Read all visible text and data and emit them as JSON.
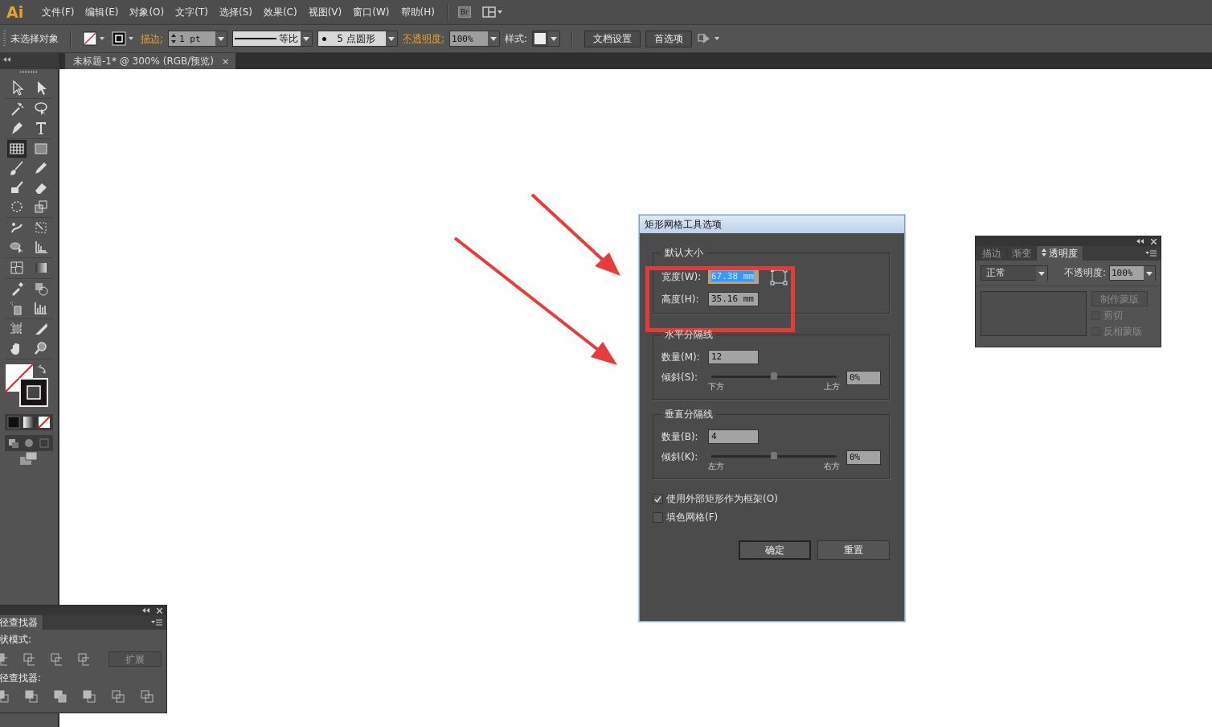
{
  "menu_bar": {
    "logo": "Ai",
    "menus": [
      "文件(F)",
      "编辑(E)",
      "对象(O)",
      "文字(T)",
      "选择(S)",
      "效果(C)",
      "视图(V)",
      "窗口(W)",
      "帮助(H)"
    ],
    "bridge": "Br"
  },
  "control_bar": {
    "selection": "未选择对象",
    "stroke_label": "描边:",
    "stroke_weight": "1 pt",
    "stroke_profile": "等比",
    "brush": "5 点圆形",
    "opacity_label": "不透明度:",
    "opacity": "100%",
    "style_label": "样式:",
    "buttons": [
      "文档设置",
      "首选项"
    ]
  },
  "document_tab": {
    "title": "未标题-1* @ 300% (RGB/预览)",
    "close": "×"
  },
  "toolbox": {
    "tools": [
      {
        "kind": "selection",
        "selected": false
      },
      {
        "kind": "direct-selection",
        "selected": false
      },
      {
        "kind": "magic-wand",
        "selected": false
      },
      {
        "kind": "lasso",
        "selected": false
      },
      {
        "kind": "pen",
        "selected": false
      },
      {
        "kind": "type",
        "selected": false
      },
      {
        "kind": "grid",
        "selected": true
      },
      {
        "kind": "rectangle",
        "selected": false
      },
      {
        "kind": "brush",
        "selected": false
      },
      {
        "kind": "pencil",
        "selected": false
      },
      {
        "kind": "blob",
        "selected": false
      },
      {
        "kind": "eraser",
        "selected": false
      },
      {
        "kind": "rotate",
        "selected": false
      },
      {
        "kind": "scale",
        "selected": false
      },
      {
        "kind": "warp",
        "selected": false
      },
      {
        "kind": "transform",
        "selected": false
      },
      {
        "kind": "builder",
        "selected": false
      },
      {
        "kind": "perspective",
        "selected": false
      },
      {
        "kind": "mesh",
        "selected": false
      },
      {
        "kind": "gradient",
        "selected": false
      },
      {
        "kind": "eyedropper",
        "selected": false
      },
      {
        "kind": "blend",
        "selected": false
      },
      {
        "kind": "sprayer",
        "selected": false
      },
      {
        "kind": "graph",
        "selected": false
      },
      {
        "kind": "artboard",
        "selected": false
      },
      {
        "kind": "slice",
        "selected": false
      },
      {
        "kind": "hand",
        "selected": false
      },
      {
        "kind": "zoom",
        "selected": false
      }
    ]
  },
  "dialog": {
    "title": "矩形网格工具选项",
    "default_size": {
      "legend": "默认大小",
      "width": {
        "label": "宽度(W):",
        "value": "67.38 mm",
        "selected": true
      },
      "height": {
        "label": "高度(H):",
        "value": "35.16 mm",
        "selected": false
      }
    },
    "dividers": [
      {
        "legend": "水平分隔线",
        "count_label": "数量(M):",
        "count": "12",
        "skew_label": "倾斜(S):",
        "level": 0.5,
        "min_label": "下方",
        "max_label": "上方",
        "skew": "0%"
      },
      {
        "legend": "垂直分隔线",
        "count_label": "数量(B):",
        "count": "4",
        "skew_label": "倾斜(K):",
        "level": 0.5,
        "min_label": "左方",
        "max_label": "右方",
        "skew": "0%"
      }
    ],
    "checkboxes": [
      {
        "label": "使用外部矩形作为框架(O)",
        "checked": true
      },
      {
        "label": "填色网格(F)",
        "checked": false
      }
    ],
    "buttons": [
      {
        "label": "确定",
        "default": true
      },
      {
        "label": "重置",
        "default": false
      }
    ]
  },
  "transparency_panel": {
    "tabs": [
      {
        "label": "描边",
        "selected": false
      },
      {
        "label": "渐变",
        "selected": false
      },
      {
        "label": "透明度",
        "selected": true
      }
    ],
    "blend_mode": "正常",
    "opacity_label": "不透明度:",
    "opacity": "100%",
    "mask_button": {
      "label": "制作蒙版",
      "disabled": true
    },
    "checkboxes": [
      {
        "label": "剪切",
        "checked": false,
        "disabled": true
      },
      {
        "label": "反相蒙版",
        "checked": false,
        "disabled": true
      }
    ]
  },
  "pathfinder_panel": {
    "title": "径查找器",
    "shape_modes_label": "状模式:",
    "expand_button": "扩展",
    "pathfinders_label": "径查找器:"
  }
}
